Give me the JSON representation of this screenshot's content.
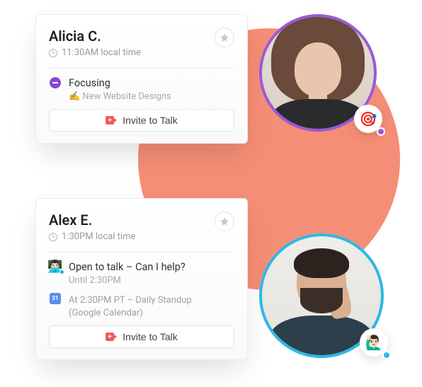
{
  "cards": [
    {
      "name": "Alicia C.",
      "time": "11:30AM local time",
      "status": {
        "icon": "dnd",
        "title": "Focusing",
        "sub_prefix": "✍️ ",
        "sub": "New Website Designs"
      },
      "invite_label": "Invite to Talk"
    },
    {
      "name": "Alex E.",
      "time": "1:30PM local time",
      "status": {
        "icon": "memoji",
        "title": "Open to talk – Can I help?",
        "sub": "Until 2:30PM"
      },
      "event": {
        "line1": "At 2:30PM PT – Daily Standup",
        "line2": "(Google Calendar)"
      },
      "invite_label": "Invite to Talk"
    }
  ],
  "badges": {
    "alicia": "🎯",
    "alex": "🙋🏻‍♂️"
  }
}
